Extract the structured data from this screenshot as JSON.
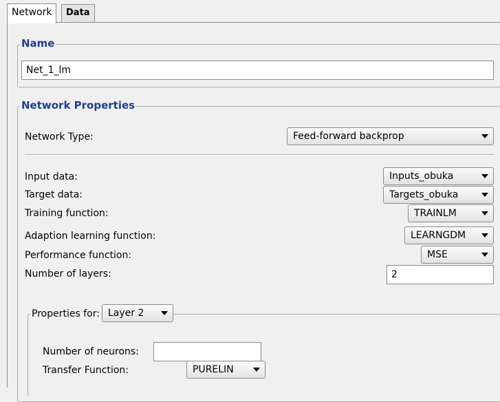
{
  "tabs": [
    {
      "label": "Network"
    },
    {
      "label": "Data"
    }
  ],
  "name_group": {
    "legend": "Name",
    "value": "Net_1_lm"
  },
  "network_properties": {
    "legend": "Network Properties",
    "network_type": {
      "label": "Network Type:",
      "value": "Feed-forward backprop"
    },
    "input_data": {
      "label": "Input data:",
      "value": "Inputs_obuka"
    },
    "target_data": {
      "label": "Target data:",
      "value": "Targets_obuka"
    },
    "training_function": {
      "label": "Training function:",
      "value": "TRAINLM"
    },
    "adaption_learning_function": {
      "label": "Adaption learning function:",
      "value": "LEARNGDM"
    },
    "performance_function": {
      "label": "Performance function:",
      "value": "MSE"
    },
    "number_of_layers": {
      "label": "Number of layers:",
      "value": "2"
    }
  },
  "layer_properties": {
    "legend": "Properties for:",
    "layer_select": "Layer 2",
    "number_of_neurons": {
      "label": "Number of neurons:",
      "value": ""
    },
    "transfer_function": {
      "label": "Transfer Function:",
      "value": "PURELIN"
    }
  },
  "colors": {
    "legend_text": "#1e3f94",
    "panel_bg": "#f0f0f0"
  }
}
